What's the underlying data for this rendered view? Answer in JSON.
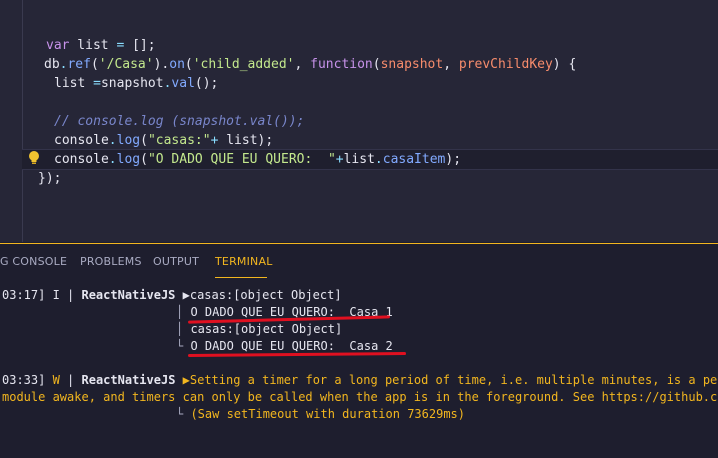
{
  "editor": {
    "lines": [
      {
        "var": "var",
        "name": " list",
        "eq": " = ",
        "val": "[];"
      },
      {
        "db": "db",
        "d1": ".",
        "ref": "ref",
        "p1": "(",
        "path": "'/Casa'",
        "p2": ").",
        "on": "on",
        "p3": "(",
        "evt": "'child_added'",
        "comma": ", ",
        "fn": "function",
        "p4": "(",
        "arg1": "snapshot",
        "comma2": ", ",
        "arg2": "prevChildKey",
        "p5": ") {"
      },
      {
        "name": "list",
        "eq": " =",
        "obj": "snapshot",
        "d": ".",
        "method": "val",
        "rest": "();"
      },
      {
        "comment": "// console.log (snapshot.val());"
      },
      {
        "obj": "console",
        "d": ".",
        "method": "log",
        "p": "(",
        "str": "\"casas:\"",
        "plus": "+ ",
        "arg": "list",
        "rest": ");"
      },
      {
        "obj": "console",
        "d": ".",
        "method": "log",
        "p": "(",
        "str": "\"O DADO QUE EU QUERO:  \"",
        "plus": "+",
        "arg": "list",
        "d2": ".",
        "prop": "casaItem",
        "rest": ");"
      },
      {
        "close": "});"
      }
    ]
  },
  "panel": {
    "tabs": [
      "G CONSOLE",
      "PROBLEMS",
      "OUTPUT",
      "TERMINAL"
    ],
    "active_tab": "TERMINAL"
  },
  "terminal": {
    "block1_prefix": "03:17] I | ",
    "block1_tag": "ReactNativeJS",
    "block1_arrow": " ▶",
    "block1_line1": "casas:[object Object]",
    "block1_line2": "O DADO QUE EU QUERO:  Casa 1",
    "block1_line3": "casas:[object Object]",
    "block1_line4": "O DADO QUE EU QUERO:  Casa 2",
    "block2_prefix": "03:33] ",
    "block2_level": "W",
    "block2_sep": " | ",
    "block2_tag": "ReactNativeJS",
    "block2_arrow": " ▶",
    "block2_line1": "Setting a timer for a long period of time, i.e. multiple minutes, is a perfo",
    "block2_line2": "module awake, and timers can only be called when the app is in the foreground. See https://github.com/f",
    "block2_line3": "(Saw setTimeout with duration 73629ms)"
  },
  "colors": {
    "accent": "#f2b61f",
    "annotation": "#e01020"
  }
}
